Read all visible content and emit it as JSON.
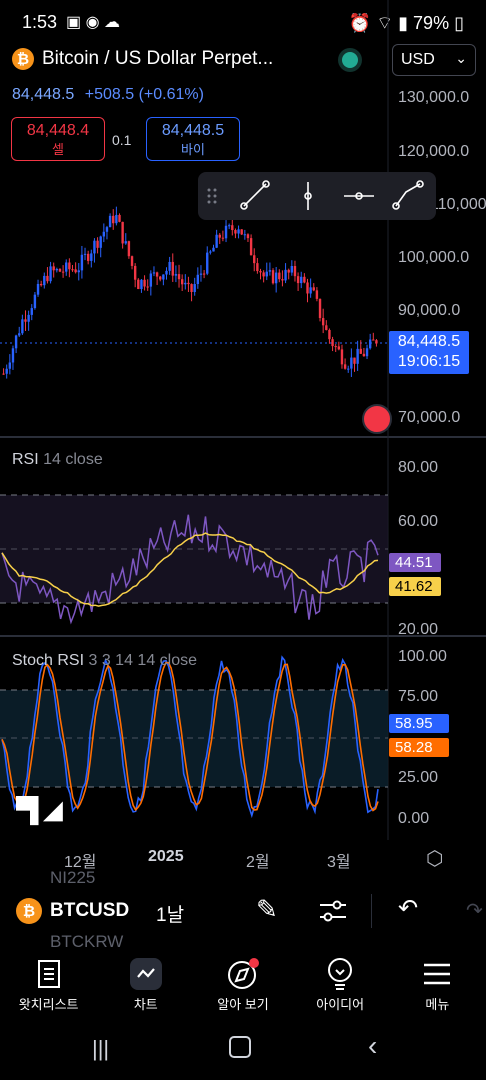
{
  "status": {
    "time": "1:53",
    "battery": "79%"
  },
  "symbol": {
    "name": "Bitcoin / US Dollar Perpet...",
    "logo_glyph": "₿",
    "currency": "USD"
  },
  "quote": {
    "price": "84,448.5",
    "change": "+508.5 (+0.61%)"
  },
  "trade": {
    "sell_price": "84,448.4",
    "sell_label": "셀",
    "spread": "0.1",
    "buy_price": "84,448.5",
    "buy_label": "바이"
  },
  "price_axis": [
    "130,000.0",
    "120,000.0",
    "110,000.0",
    "100,000.0",
    "90,000.0",
    "70,000.0"
  ],
  "last_price_tag": {
    "price": "84,448.5",
    "countdown": "19:06:15"
  },
  "rsi": {
    "title": "RSI",
    "params": "14 close",
    "axis": [
      "80.00",
      "60.00",
      "20.00"
    ],
    "rsi_value": "44.51",
    "ma_value": "41.62"
  },
  "stoch": {
    "title": "Stoch RSI",
    "params": "3 3 14 14 close",
    "axis": [
      "100.00",
      "75.00",
      "25.00",
      "0.00"
    ],
    "k_value": "58.95",
    "d_value": "58.28"
  },
  "time_axis": [
    "12월",
    "2025",
    "2월",
    "3월"
  ],
  "bottom_toolbar": {
    "symbol": "BTCUSD",
    "interval": "1날",
    "ghost1": "NI225",
    "ghost2": "BTCKRW"
  },
  "nav": [
    {
      "label": "왓치리스트"
    },
    {
      "label": "차트"
    },
    {
      "label": "알아 보기"
    },
    {
      "label": "아이디어"
    },
    {
      "label": "메뉴"
    }
  ],
  "colors": {
    "up": "#2962ff",
    "down": "#f23645",
    "rsi": "#7e57c2",
    "rsi_ma": "#f7d04a",
    "stoch_k": "#2962ff",
    "stoch_d": "#ff6d00"
  }
}
